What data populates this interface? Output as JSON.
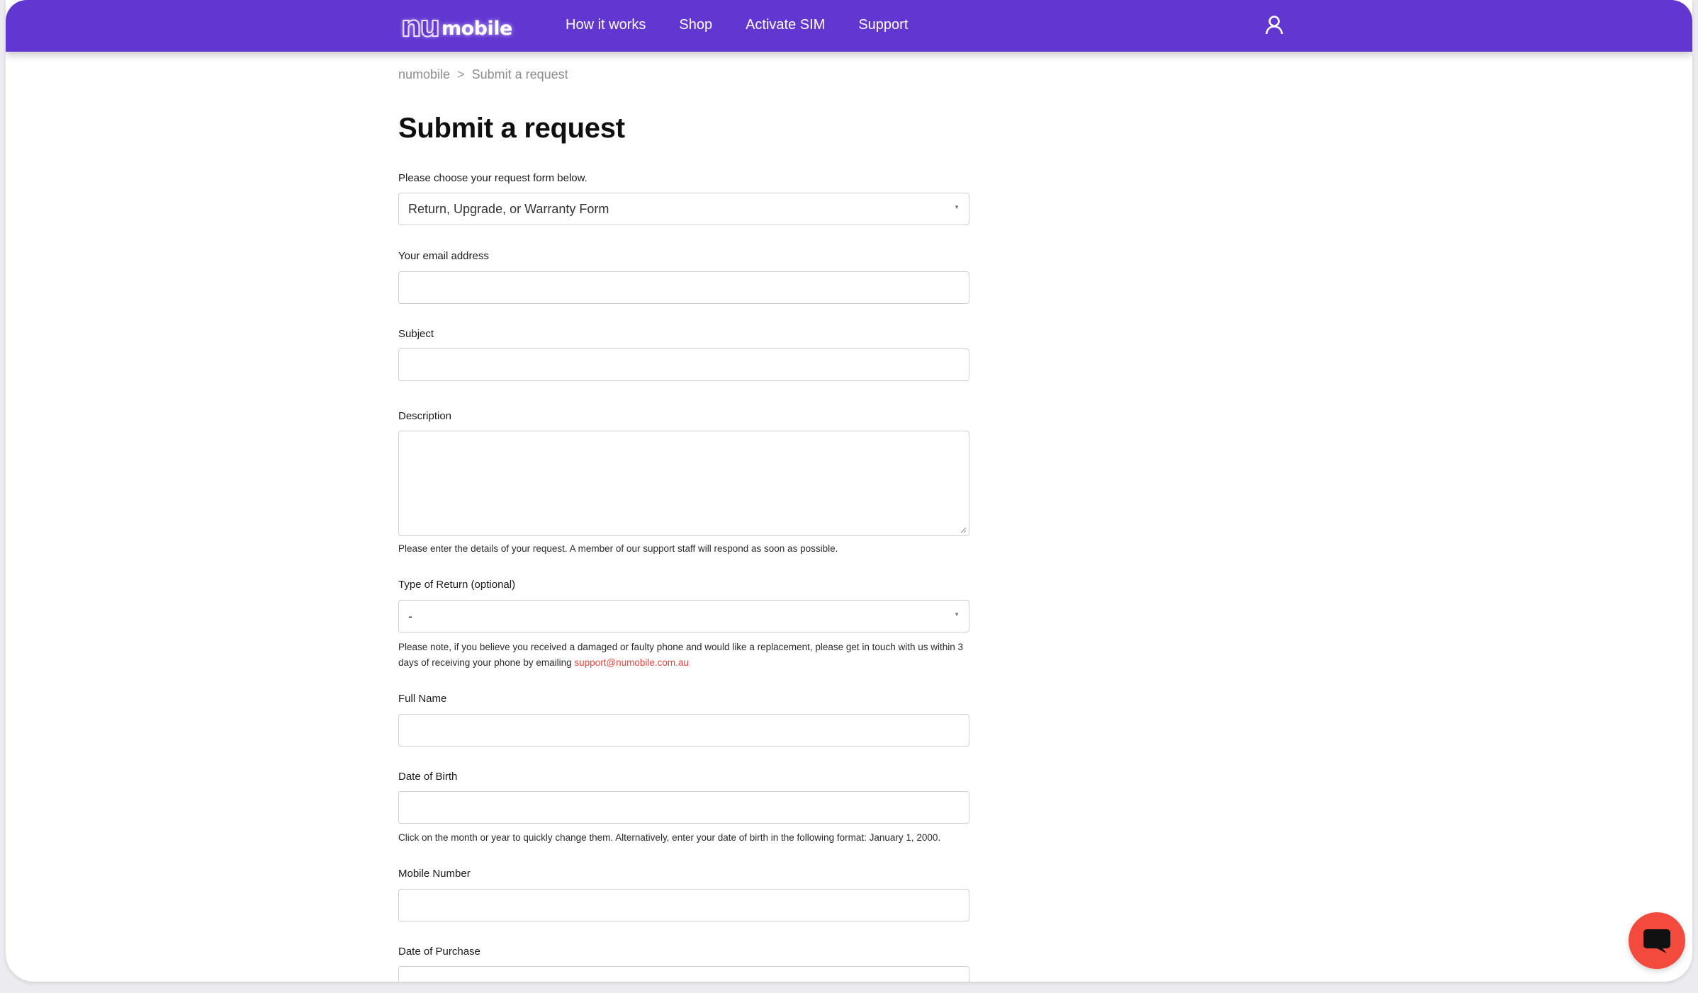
{
  "brand": {
    "logo_nu": "nu",
    "logo_mobile": "mobile",
    "primary_color": "#6237d1",
    "link_color": "#e8453c",
    "chat_color": "#f24a3c"
  },
  "nav": {
    "items": [
      {
        "label": "How it works"
      },
      {
        "label": "Shop"
      },
      {
        "label": "Activate SIM"
      },
      {
        "label": "Support"
      }
    ],
    "account_icon": "user-icon"
  },
  "breadcrumb": {
    "home": "numobile",
    "separator": ">",
    "current": "Submit a request"
  },
  "page": {
    "title": "Submit a request"
  },
  "form": {
    "request_form": {
      "label": "Please choose your request form below.",
      "value": "Return, Upgrade, or Warranty Form"
    },
    "email": {
      "label": "Your email address",
      "value": ""
    },
    "subject": {
      "label": "Subject",
      "value": ""
    },
    "description": {
      "label": "Description",
      "value": "",
      "help": "Please enter the details of your request. A member of our support staff will respond as soon as possible."
    },
    "return_type": {
      "label": "Type of Return (optional)",
      "value": "-",
      "help_prefix": "Please note, if you believe you received a damaged or faulty phone and would like a replacement, please get in touch with us within 3 days of receiving your phone by emailing ",
      "help_link": "support@numobile.com.au"
    },
    "full_name": {
      "label": "Full Name",
      "value": ""
    },
    "dob": {
      "label": "Date of Birth",
      "value": "",
      "help": "Click on the month or year to quickly change them. Alternatively, enter your date of birth in the following format: January 1, 2000."
    },
    "mobile": {
      "label": "Mobile Number",
      "value": ""
    },
    "purchase_date": {
      "label": "Date of Purchase",
      "value": ""
    }
  },
  "chat": {
    "icon": "chat-bubble-icon"
  }
}
